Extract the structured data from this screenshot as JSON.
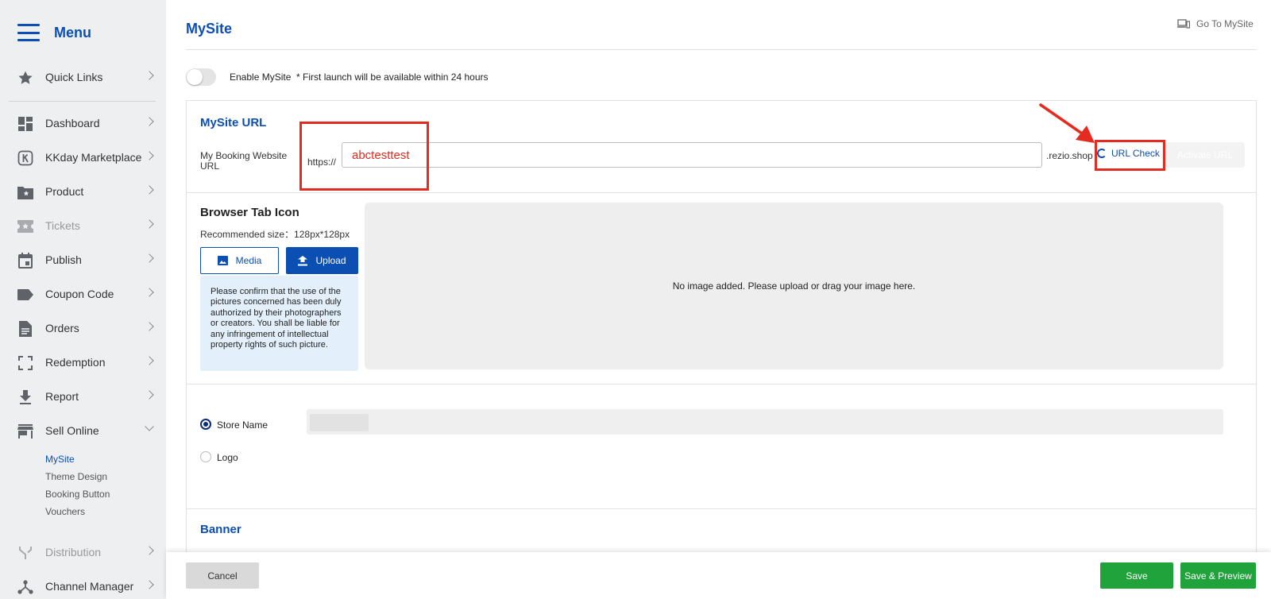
{
  "sidebar": {
    "title": "Menu",
    "items": [
      {
        "label": "Quick Links"
      },
      {
        "label": "Dashboard"
      },
      {
        "label": "KKday Marketplace"
      },
      {
        "label": "Product"
      },
      {
        "label": "Tickets"
      },
      {
        "label": "Publish"
      },
      {
        "label": "Coupon Code"
      },
      {
        "label": "Orders"
      },
      {
        "label": "Redemption"
      },
      {
        "label": "Report"
      },
      {
        "label": "Sell Online"
      },
      {
        "label": "Distribution"
      },
      {
        "label": "Channel Manager"
      }
    ],
    "sell_online_sub": [
      "MySite",
      "Theme Design",
      "Booking Button",
      "Vouchers"
    ]
  },
  "header": {
    "title": "MySite",
    "goto_label": "Go To MySite"
  },
  "enable": {
    "label": "Enable MySite",
    "note": "* First launch will be available within 24 hours"
  },
  "url_section": {
    "heading": "MySite URL",
    "field_label": "My Booking Website URL",
    "prefix": "https://",
    "value": "abctesttest",
    "suffix": ".rezio.shop",
    "check_label": "URL Check",
    "activate_label": "Activate URL"
  },
  "tab_icon": {
    "heading": "Browser Tab Icon",
    "size_note": "Recommended size：128px*128px",
    "media_label": "Media",
    "upload_label": "Upload",
    "notice": "Please confirm that the use of the pictures concerned has been duly authorized by their photographers or creators. You shall be liable for any infringement of intellectual property rights of such picture.",
    "dropzone": "No image added. Please upload or drag your image here."
  },
  "brand": {
    "store_name_label": "Store Name",
    "logo_label": "Logo"
  },
  "banner": {
    "heading": "Banner"
  },
  "footer": {
    "cancel_label": "Cancel",
    "save_label": "Save",
    "save_preview_label": "Save & Preview"
  },
  "colors": {
    "brand_blue": "#0b4fb3",
    "annotation_red": "#e52b1f",
    "save_green": "#1fa33a"
  }
}
